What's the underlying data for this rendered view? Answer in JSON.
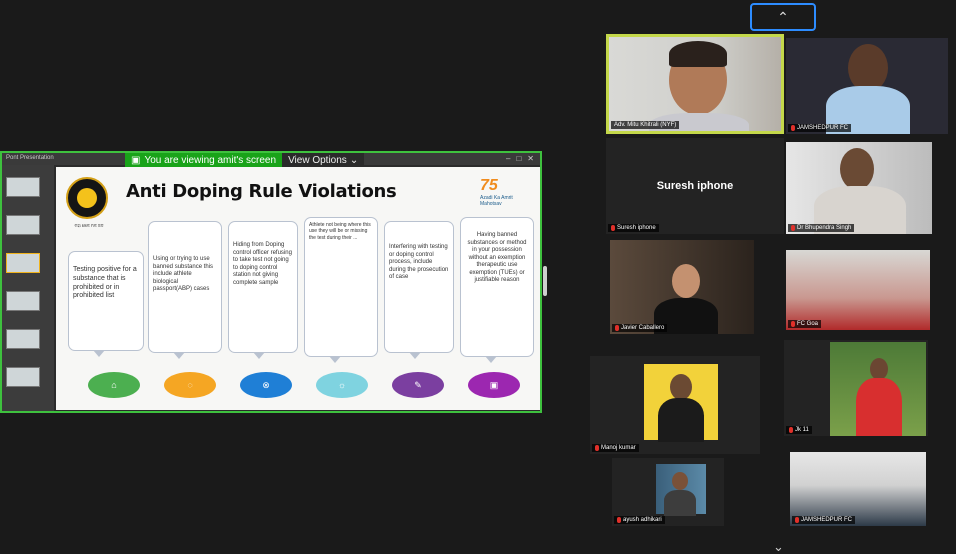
{
  "share": {
    "banner": "You are viewing amit's screen",
    "view_options": "View Options",
    "window_title": "Pont Presentation",
    "slide": {
      "title": "Anti Doping Rule Violations",
      "logo_caption": "ମହା ଖେଳ ମଳ ଜଳ",
      "azadi_num": "75",
      "azadi_text": "Azadi Ka Amrit Mahotsav",
      "bubbles": [
        "Testing positive for a substance that is prohibited or in prohibited list",
        "Using or trying to use banned substance this include athlete biological passport(ABP) cases",
        "Hiding from Doping control officer refusing to take test not going to doping control station not giving complete sample",
        "Athlete not being where this use they will be or missing the test during their ...",
        "Interfering with testing or doping control process, include during the prosecution of case",
        "Having banned substances or method in your possession without an exemption therapeutic use exemption (TUEs) or justifiable reason"
      ],
      "oval_colors": [
        "#4caf50",
        "#f5a623",
        "#1f7fd6",
        "#7fd3e0",
        "#7b3fa0",
        "#9c27b0"
      ]
    }
  },
  "gallery": {
    "participants": [
      {
        "name": "Adv. Mitu Khitrali (NYF)",
        "active": true
      },
      {
        "name": "JAMSHEDPUR FC"
      },
      {
        "name": "Suresh iphone",
        "video_off_label": "Suresh iphone"
      },
      {
        "name": "Dr Bhupendra Singh"
      },
      {
        "name": "Javier Caballero"
      },
      {
        "name": "FC Goa"
      },
      {
        "name": "Manoj kumar"
      },
      {
        "name": "Jk 11"
      },
      {
        "name": "ayush adhikari"
      },
      {
        "name": "JAMSHEDPUR FC"
      }
    ]
  }
}
